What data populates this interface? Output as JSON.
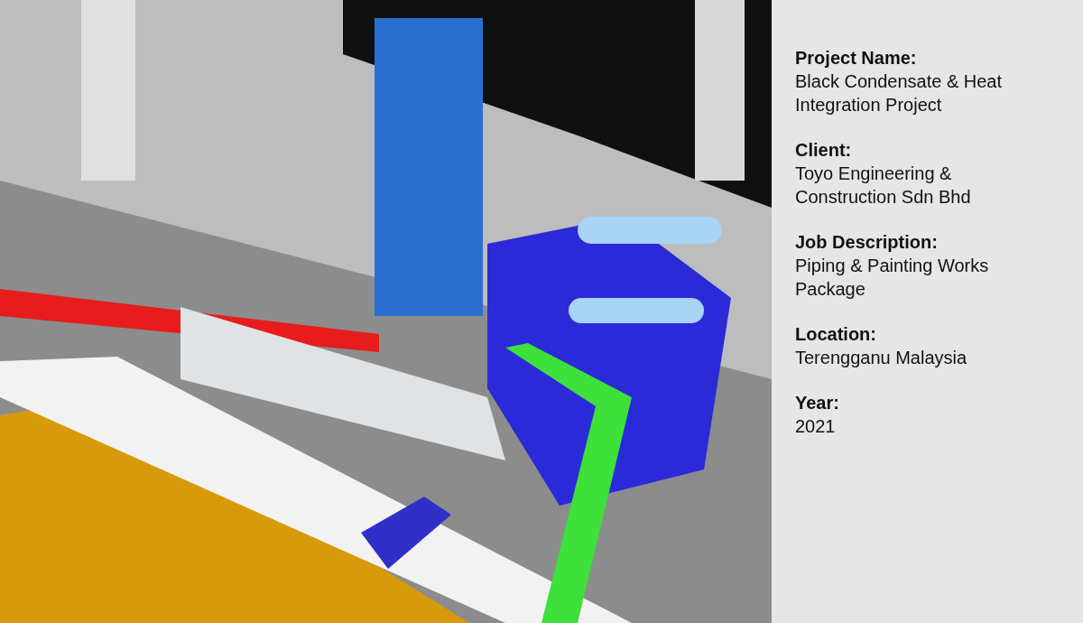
{
  "details": [
    {
      "label": "Project Name:",
      "value": "Black Condensate & Heat Integration Project"
    },
    {
      "label": "Client:",
      "value": "Toyo Engineering & Construction Sdn Bhd"
    },
    {
      "label": "Job Description:",
      "value": "Piping & Painting Works Package"
    },
    {
      "label": "Location:",
      "value": "Terengganu Malaysia"
    },
    {
      "label": "Year:",
      "value": "2021"
    }
  ]
}
